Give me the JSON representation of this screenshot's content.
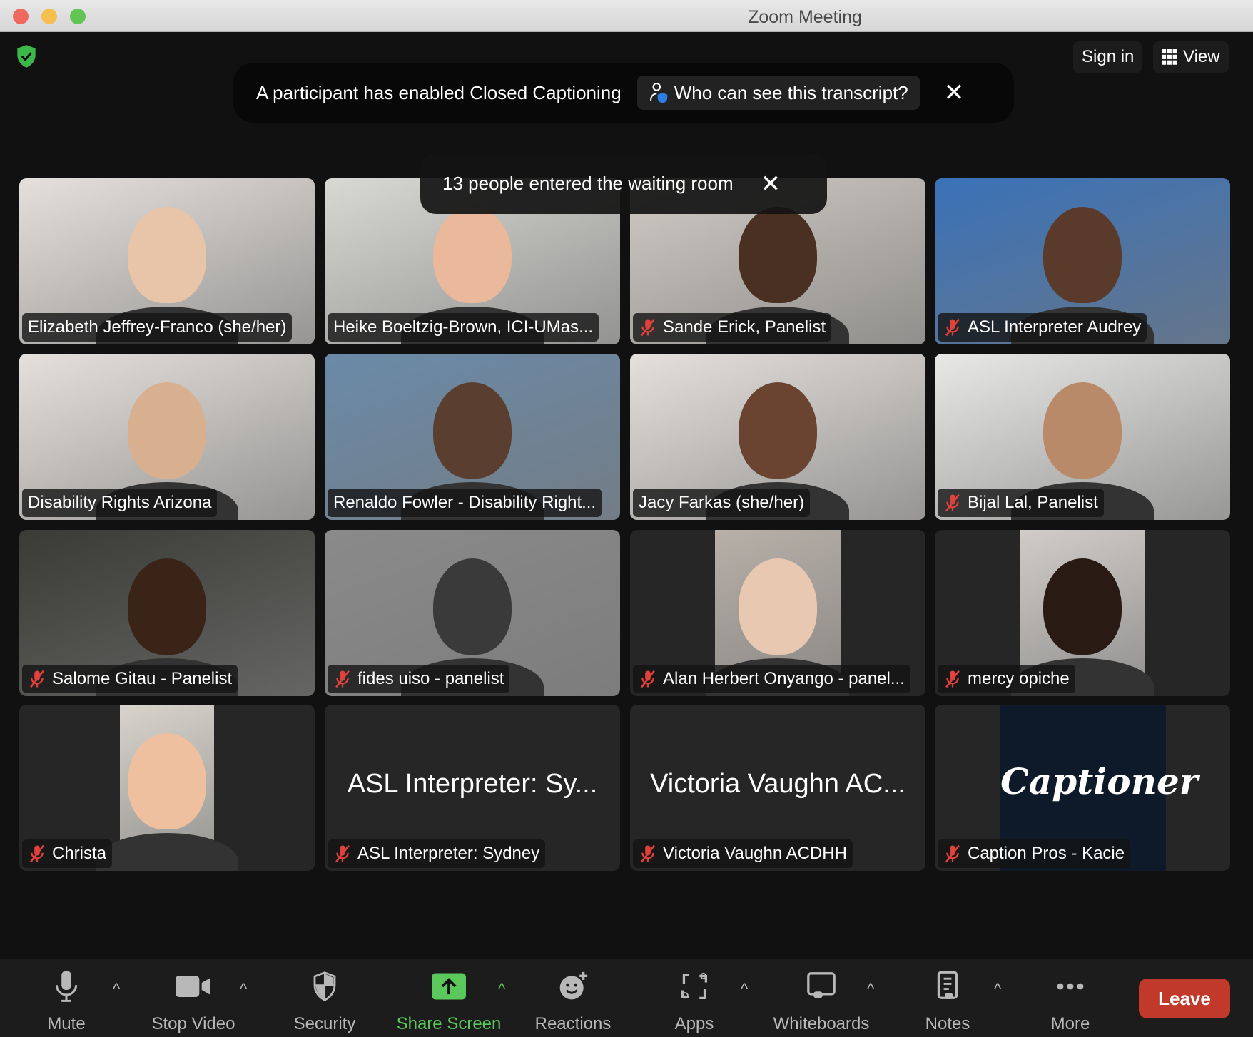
{
  "window": {
    "title": "Zoom Meeting"
  },
  "header": {
    "sign_in": "Sign in",
    "view": "View"
  },
  "cc_banner": {
    "text": "A participant has enabled Closed Captioning",
    "who_button": "Who can see this transcript?"
  },
  "waiting_toast": {
    "text": "13 people entered the waiting room"
  },
  "participants": [
    {
      "name": "Elizabeth Jeffrey-Franco (she/her)",
      "muted": false,
      "bg": "#e4e0dc",
      "skin": "#e8c4a8"
    },
    {
      "name": "Heike Boeltzig-Brown, ICI-UMas...",
      "muted": false,
      "bg": "#d8d8d4",
      "skin": "#eab89a"
    },
    {
      "name": "Sande Erick, Panelist",
      "muted": true,
      "bg": "#cfcac3",
      "skin": "#4a3022"
    },
    {
      "name": "ASL Interpreter Audrey",
      "muted": true,
      "bg": "#3a72b8",
      "skin": "#5a3a2a"
    },
    {
      "name": "Disability Rights Arizona",
      "muted": false,
      "bg": "#e4e0dc",
      "skin": "#d8b090"
    },
    {
      "name": "Renaldo Fowler - Disability Right...",
      "muted": false,
      "bg": "#6a8aa8",
      "skin": "#5a3e30"
    },
    {
      "name": "Jacy Farkas (she/her)",
      "muted": false,
      "bg": "#e4e0dc",
      "skin": "#6a4430",
      "speaking": true
    },
    {
      "name": "Bijal Lal, Panelist",
      "muted": true,
      "bg": "#e8e8e6",
      "skin": "#b88a6a"
    },
    {
      "name": "Salome Gitau - Panelist",
      "muted": true,
      "bg": "#3a3a36",
      "skin": "#3a2418"
    },
    {
      "name": "fides uiso - panelist",
      "muted": true,
      "bg": "#8a8a8a",
      "skin": "#3a3a3a"
    },
    {
      "name": "Alan Herbert Onyango - panel...",
      "muted": true,
      "bg": "#b8b0a8",
      "skin": "#e8c8b0"
    },
    {
      "name": "mercy opiche",
      "muted": true,
      "bg": "#d0ccc8",
      "skin": "#2a1a14"
    },
    {
      "name": "Christa",
      "muted": true,
      "bg": "#d8d4cc",
      "skin": "#eec0a0"
    },
    {
      "name": "ASL Interpreter: Sydney",
      "muted": true,
      "big": "ASL Interpreter: Sy..."
    },
    {
      "name": "Victoria Vaughn ACDHH",
      "muted": true,
      "big": "Victoria Vaughn AC..."
    },
    {
      "name": "Caption Pros - Kacie",
      "muted": true,
      "logo": "Captioner"
    }
  ],
  "toolbar": {
    "items": [
      {
        "label": "Mute",
        "icon": "microphone-icon"
      },
      {
        "label": "Stop Video",
        "icon": "video-camera-icon"
      },
      {
        "label": "Security",
        "icon": "shield-icon"
      },
      {
        "label": "Share Screen",
        "icon": "share-screen-icon"
      },
      {
        "label": "Reactions",
        "icon": "reaction-smiley-icon"
      },
      {
        "label": "Apps",
        "icon": "apps-icon"
      },
      {
        "label": "Whiteboards",
        "icon": "whiteboard-icon"
      },
      {
        "label": "Notes",
        "icon": "notes-icon"
      },
      {
        "label": "More",
        "icon": "more-dots-icon"
      }
    ],
    "leave": "Leave"
  },
  "colors": {
    "accent_green": "#5ac85a",
    "leave_red": "#c0392b",
    "mic_muted_red": "#e0413a"
  }
}
